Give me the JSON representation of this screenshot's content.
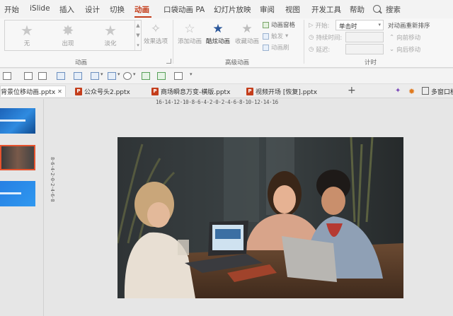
{
  "menu": {
    "items": [
      "开始",
      "iSlide",
      "插入",
      "设计",
      "切换",
      "动画",
      "口袋动画 PA",
      "幻灯片放映",
      "审阅",
      "视图",
      "开发工具",
      "帮助"
    ],
    "active": "动画",
    "search_label": "搜索"
  },
  "ribbon": {
    "gallery": [
      {
        "label": "无",
        "icon": "star-icon"
      },
      {
        "label": "出现",
        "icon": "star-burst-icon"
      },
      {
        "label": "淡化",
        "icon": "star-icon"
      }
    ],
    "effect_options": "效果选项",
    "add_animation": "添加动画",
    "cool_animation": "酷炫动画",
    "collect_animation": "收藏动画",
    "animation_pane": "动画窗格",
    "trigger": "触发",
    "animation_painter": "动画刷",
    "start_label": "开始:",
    "start_value": "单击时",
    "duration_label": "持续时间:",
    "delay_label": "延迟:",
    "reorder_title": "对动画重新排序",
    "move_earlier": "向前移动",
    "move_later": "向后移动",
    "groups": {
      "animation": "动画",
      "advanced": "高级动画",
      "timing": "计时"
    }
  },
  "doc_tabs": [
    {
      "label": "背景位移动画.pptx",
      "active": true
    },
    {
      "label": "公众号头2.pptx",
      "active": false
    },
    {
      "label": "商场瞬息万变-横版.pptx",
      "active": false
    },
    {
      "label": "视频开场 [恢复].pptx",
      "active": false
    }
  ],
  "tabbar_right": "多窗口模",
  "ruler_h": "16·14·12·10·8·6·4·2·0·2·4·6·8·10·12·14·16",
  "ruler_v": "8·6·4·2·0·2·4·6·8",
  "colors": {
    "accent": "#c43e1c",
    "thumb_selected_border": "#e5532f",
    "ribbon_bg": "#f7f7f7"
  }
}
